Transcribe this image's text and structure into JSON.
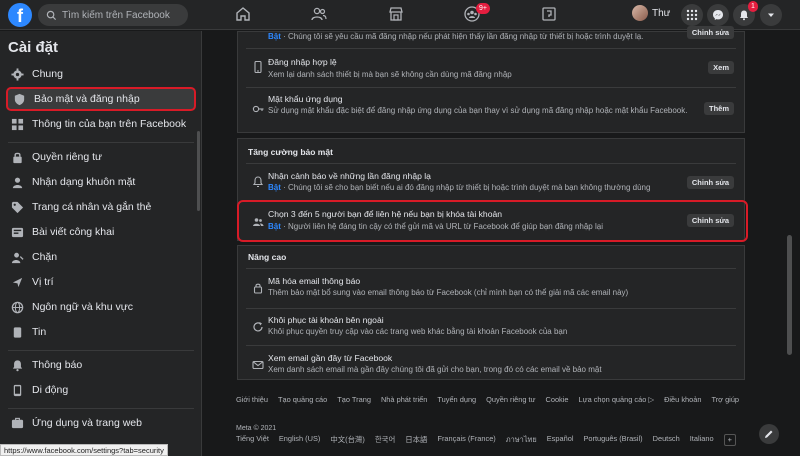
{
  "topbar": {
    "logo": "f",
    "search_placeholder": "Tìm kiếm trên Facebook",
    "groups_badge": "9+",
    "profile_name": "Thư",
    "notifications_badge": "1"
  },
  "sidebar": {
    "title": "Cài đặt",
    "items": [
      {
        "label": "Chung",
        "icon": "gear-icon"
      },
      {
        "label": "Bảo mật và đăng nhập",
        "icon": "shield-icon"
      },
      {
        "label": "Thông tin của bạn trên Facebook",
        "icon": "grid-icon"
      },
      {
        "label": "Quyền riêng tư",
        "icon": "lock-icon"
      },
      {
        "label": "Nhận dạng khuôn mặt",
        "icon": "face-icon"
      },
      {
        "label": "Trang cá nhân và gắn thẻ",
        "icon": "tag-icon"
      },
      {
        "label": "Bài viết công khai",
        "icon": "globe-icon"
      },
      {
        "label": "Chặn",
        "icon": "block-icon"
      },
      {
        "label": "Vị trí",
        "icon": "location-icon"
      },
      {
        "label": "Ngôn ngữ và khu vực",
        "icon": "language-icon"
      },
      {
        "label": "Tin",
        "icon": "stories-icon"
      },
      {
        "label": "Thông báo",
        "icon": "bell-icon"
      },
      {
        "label": "Di động",
        "icon": "mobile-icon"
      },
      {
        "label": "Ứng dụng và trang web",
        "icon": "apps-icon"
      }
    ],
    "status_url": "https://www.facebook.com/settings?tab=security"
  },
  "main": {
    "top_card": {
      "rows": [
        {
          "title": "",
          "desc_prefix": "Bật",
          "desc": " · Chúng tôi sẽ yêu cầu mã đăng nhập nếu phát hiện thấy lần đăng nhập từ thiết bị hoặc trình duyệt lạ.",
          "button": "Chỉnh sửa"
        },
        {
          "title": "Đăng nhập hợp lệ",
          "desc_prefix": "",
          "desc": "Xem lại danh sách thiết bị mà bạn sẽ không cần dùng mã đăng nhập",
          "button": "Xem"
        },
        {
          "title": "Mật khẩu ứng dụng",
          "desc_prefix": "",
          "desc": "Sử dụng mật khẩu đặc biệt để đăng nhập ứng dụng của bạn thay vì sử dụng mã đăng nhập hoặc mật khẩu Facebook.",
          "button": "Thêm"
        }
      ]
    },
    "security_section": {
      "title": "Tăng cường bảo mật",
      "rows": [
        {
          "title": "Nhận cảnh báo về những lần đăng nhập lạ",
          "desc_prefix": "Bật",
          "desc": " · Chúng tôi sẽ cho bạn biết nếu ai đó đăng nhập từ thiết bị hoặc trình duyệt mà bạn không thường dùng",
          "button": "Chỉnh sửa"
        },
        {
          "title": "Chọn 3 đến 5 người bạn để liên hệ nếu bạn bị khóa tài khoản",
          "desc_prefix": "Bật",
          "desc": " · Người liên hệ đáng tin cậy có thể gửi mã và URL từ Facebook để giúp bạn đăng nhập lại",
          "button": "Chỉnh sửa"
        }
      ]
    },
    "advanced_section": {
      "title": "Nâng cao",
      "rows": [
        {
          "title": "Mã hóa email thông báo",
          "desc": "Thêm bảo mật bổ sung vào email thông báo từ Facebook (chỉ mình bạn có thể giải mã các email này)"
        },
        {
          "title": "Khôi phục tài khoản bên ngoài",
          "desc": "Khôi phục quyền truy cập vào các trang web khác bằng tài khoản Facebook của bạn"
        },
        {
          "title": "Xem email gần đây từ Facebook",
          "desc": "Xem danh sách email mà gần đây chúng tôi đã gửi cho bạn, trong đó có các email về bảo mật"
        }
      ]
    }
  },
  "footer": {
    "links": [
      "Giới thiệu",
      "Tạo quảng cáo",
      "Tạo Trang",
      "Nhà phát triển",
      "Tuyển dụng",
      "Quyền riêng tư",
      "Cookie",
      "Lựa chọn quảng cáo ▷",
      "Điều khoản",
      "Trợ giúp"
    ],
    "copyright": "Meta © 2021",
    "languages": [
      "Tiếng Việt",
      "English (US)",
      "中文(台灣)",
      "한국어",
      "日本語",
      "Français (France)",
      "ภาษาไทย",
      "Español",
      "Português (Brasil)",
      "Deutsch",
      "Italiano"
    ],
    "more": "+"
  }
}
